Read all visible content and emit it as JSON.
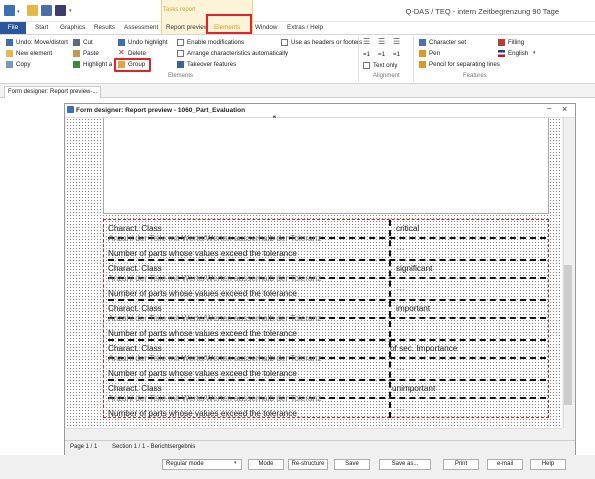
{
  "app": {
    "title": "Q-DAS / TEQ - intern Zeitbegrenzung 90 Tage"
  },
  "ribbon_tabs": {
    "file": "File",
    "start": "Start",
    "graphics": "Graphics",
    "results": "Results",
    "assessment": "Assessment",
    "report_preview": "Report preview",
    "elements": "Elements",
    "window": "Window",
    "extras_help": "Extras / Help",
    "context_group": "Tasks report"
  },
  "ribbon": {
    "undo_move": "Undo: Move/distort",
    "new_element": "New element",
    "copy": "Copy",
    "cut": "Cut",
    "paste": "Paste",
    "highlight": "Highlight a",
    "undo_highlight": "Undo highlight",
    "delete": "Delete",
    "group": "Group",
    "group_elements": "Elements",
    "enable_modifications": "Enable modifications",
    "arrange_characteristics": "Arrange characteristics automatically",
    "takeover_features": "Takeover features",
    "use_as_headers": "Use as headers or footers",
    "text_only": "Text only",
    "group_alignment": "Alignment",
    "character_set": "Character set",
    "pen": "Pen",
    "pencil_separating": "Pencil for separating lines",
    "filling": "Filling",
    "english": "English",
    "group_features": "Features",
    "align_labels": [
      "=1",
      "=1",
      "=1"
    ]
  },
  "doc_tab": "Form designer: Report preview-...",
  "form_designer": {
    "title": "Form designer: Report preview - 1060_Part_Evaluation",
    "minimize": "–",
    "close": "×",
    "rows": [
      {
        "label": "Charact. Class",
        "value": "critical",
        "german": "Anzahl der Teile mit Werte/Werten ausserhalb der Toleranz",
        "english": "Number of parts whose values exceed the tolerance"
      },
      {
        "label": "Charact. Class",
        "value": "significant",
        "german": "Anzahl der Teile mit Werte/Werten ausserhalb der Toleranz",
        "english": "Number of parts whose values exceed the tolerance"
      },
      {
        "label": "Charact. Class",
        "value": "important",
        "german": "Anzahl der Teile mit Werte/Werten ausserhalb der Toleranz",
        "english": "Number of parts whose values exceed the tolerance"
      },
      {
        "label": "Charact. Class",
        "value": "of sec. Importance",
        "german": "Anzahl der Teile mit Werte/Werten ausserhalb der Toleranz",
        "english": "Number of parts whose values exceed the tolerance"
      },
      {
        "label": "Charact. Class",
        "value": "unimportant",
        "german": "Anzahl der Teile mit Werte/Werten ausserhalb der Toleranz",
        "english": "Number of parts whose values exceed the tolerance"
      }
    ],
    "status": {
      "page": "Page 1 / 1",
      "section": "Section 1 / 1 - Berichtsergebnis"
    }
  },
  "bottom": {
    "mode": "Regular mode",
    "mode_btn": "Mode",
    "restructure": "Re-structure",
    "save": "Save",
    "save_as": "Save as...",
    "print": "Print",
    "email": "e-mail",
    "help": "Help"
  },
  "colors": {
    "accent": "#2b579a",
    "highlight_red": "#e0242b",
    "context_tab": "#fdf4d8"
  }
}
